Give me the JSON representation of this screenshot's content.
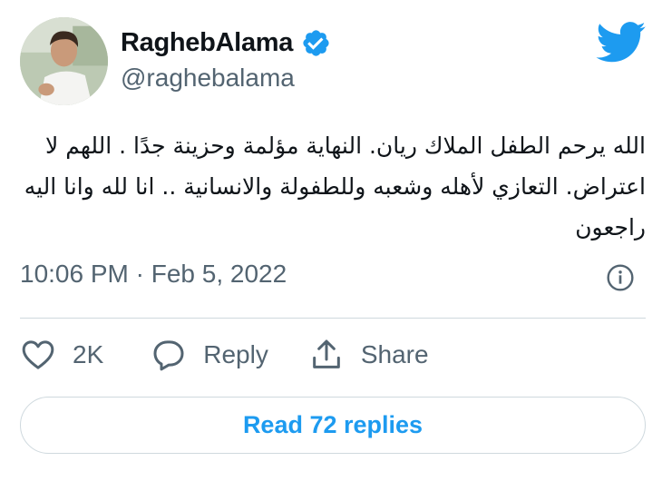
{
  "author": {
    "display_name": "RaghebAlama",
    "handle": "@raghebalama",
    "verified": true
  },
  "tweet": {
    "text": "الله يرحم الطفل الملاك ريان. النهاية مؤلمة وحزينة جدًا . اللهم لا اعتراض. التعازي لأهله وشعبه وللطفولة والانسانية .. انا لله وانا اليه راجعون",
    "timestamp": "10:06 PM · Feb 5, 2022"
  },
  "actions": {
    "like_count": "2K",
    "reply_label": "Reply",
    "share_label": "Share"
  },
  "read_replies_label": "Read 72 replies",
  "icons": {
    "brand": "twitter-bird-icon",
    "verified": "verified-badge-icon",
    "info": "info-icon",
    "like": "heart-icon",
    "reply": "speech-bubble-icon",
    "share": "share-upload-icon"
  },
  "colors": {
    "accent": "#1d9bf0",
    "text": "#0f1419",
    "secondary": "#536471",
    "border": "#cfd9de"
  }
}
